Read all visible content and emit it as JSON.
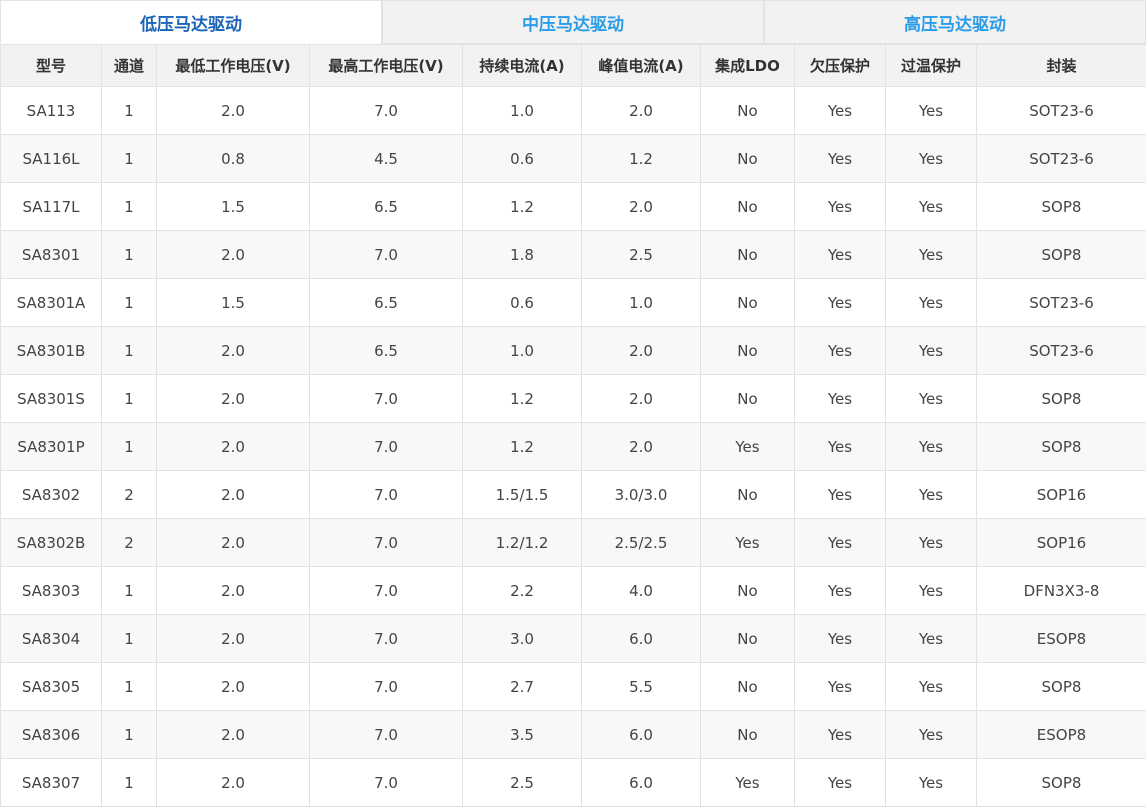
{
  "tabs": [
    {
      "label": "低压马达驱动",
      "active": true
    },
    {
      "label": "中压马达驱动",
      "active": false
    },
    {
      "label": "高压马达驱动",
      "active": false
    }
  ],
  "colors": {
    "active_tab_text": "#1b64b8",
    "tab_text": "#2a9ce8",
    "header_bg": "#f2f2f2"
  },
  "table": {
    "headers": [
      "型号",
      "通道",
      "最低工作电压(V)",
      "最高工作电压(V)",
      "持续电流(A)",
      "峰值电流(A)",
      "集成LDO",
      "欠压保护",
      "过温保护",
      "封装"
    ],
    "rows": [
      [
        "SA113",
        "1",
        "2.0",
        "7.0",
        "1.0",
        "2.0",
        "No",
        "Yes",
        "Yes",
        "SOT23-6"
      ],
      [
        "SA116L",
        "1",
        "0.8",
        "4.5",
        "0.6",
        "1.2",
        "No",
        "Yes",
        "Yes",
        "SOT23-6"
      ],
      [
        "SA117L",
        "1",
        "1.5",
        "6.5",
        "1.2",
        "2.0",
        "No",
        "Yes",
        "Yes",
        "SOP8"
      ],
      [
        "SA8301",
        "1",
        "2.0",
        "7.0",
        "1.8",
        "2.5",
        "No",
        "Yes",
        "Yes",
        "SOP8"
      ],
      [
        "SA8301A",
        "1",
        "1.5",
        "6.5",
        "0.6",
        "1.0",
        "No",
        "Yes",
        "Yes",
        "SOT23-6"
      ],
      [
        "SA8301B",
        "1",
        "2.0",
        "6.5",
        "1.0",
        "2.0",
        "No",
        "Yes",
        "Yes",
        "SOT23-6"
      ],
      [
        "SA8301S",
        "1",
        "2.0",
        "7.0",
        "1.2",
        "2.0",
        "No",
        "Yes",
        "Yes",
        "SOP8"
      ],
      [
        "SA8301P",
        "1",
        "2.0",
        "7.0",
        "1.2",
        "2.0",
        "Yes",
        "Yes",
        "Yes",
        "SOP8"
      ],
      [
        "SA8302",
        "2",
        "2.0",
        "7.0",
        "1.5/1.5",
        "3.0/3.0",
        "No",
        "Yes",
        "Yes",
        "SOP16"
      ],
      [
        "SA8302B",
        "2",
        "2.0",
        "7.0",
        "1.2/1.2",
        "2.5/2.5",
        "Yes",
        "Yes",
        "Yes",
        "SOP16"
      ],
      [
        "SA8303",
        "1",
        "2.0",
        "7.0",
        "2.2",
        "4.0",
        "No",
        "Yes",
        "Yes",
        "DFN3X3-8"
      ],
      [
        "SA8304",
        "1",
        "2.0",
        "7.0",
        "3.0",
        "6.0",
        "No",
        "Yes",
        "Yes",
        "ESOP8"
      ],
      [
        "SA8305",
        "1",
        "2.0",
        "7.0",
        "2.7",
        "5.5",
        "No",
        "Yes",
        "Yes",
        "SOP8"
      ],
      [
        "SA8306",
        "1",
        "2.0",
        "7.0",
        "3.5",
        "6.0",
        "No",
        "Yes",
        "Yes",
        "ESOP8"
      ],
      [
        "SA8307",
        "1",
        "2.0",
        "7.0",
        "2.5",
        "6.0",
        "Yes",
        "Yes",
        "Yes",
        "SOP8"
      ]
    ]
  }
}
